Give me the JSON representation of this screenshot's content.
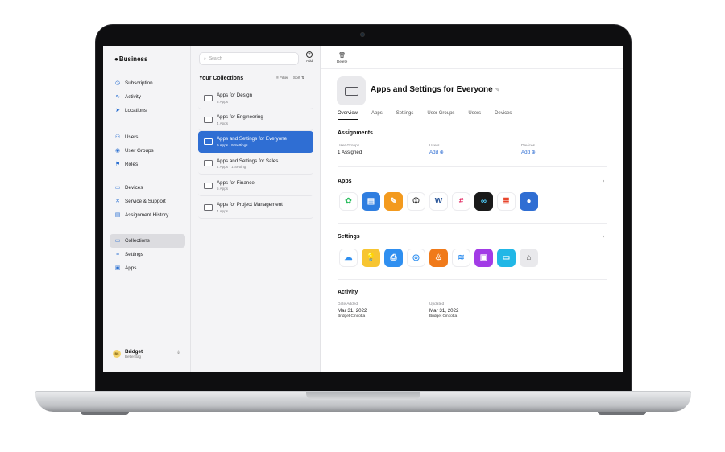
{
  "sidebar": {
    "brand": "Business",
    "groups": [
      [
        {
          "label": "Subscription",
          "icon": "clock-icon"
        },
        {
          "label": "Activity",
          "icon": "activity-icon"
        },
        {
          "label": "Locations",
          "icon": "location-icon"
        }
      ],
      [
        {
          "label": "Users",
          "icon": "users-icon"
        },
        {
          "label": "User Groups",
          "icon": "user-group-icon"
        },
        {
          "label": "Roles",
          "icon": "flag-icon"
        }
      ],
      [
        {
          "label": "Devices",
          "icon": "devices-icon"
        },
        {
          "label": "Service & Support",
          "icon": "tools-icon"
        },
        {
          "label": "Assignment History",
          "icon": "history-icon"
        }
      ],
      [
        {
          "label": "Collections",
          "icon": "collections-icon",
          "active": true
        },
        {
          "label": "Settings",
          "icon": "settings-icon"
        },
        {
          "label": "Apps",
          "icon": "apps-icon"
        }
      ]
    ],
    "user": {
      "initials": "BC",
      "name": "Bridget",
      "org": "BetterBag"
    }
  },
  "collections": {
    "search_placeholder": "Search",
    "add_label": "Add",
    "title": "Your Collections",
    "filter_label": "Filter",
    "sort_label": "Sort",
    "items": [
      {
        "name": "Apps for Design",
        "meta": "3 Apps"
      },
      {
        "name": "Apps for Engineering",
        "meta": "4 Apps"
      },
      {
        "name": "Apps and Settings for Everyone",
        "meta": "9 Apps · 9 Settings",
        "selected": true
      },
      {
        "name": "Apps and Settings for Sales",
        "meta": "4 Apps · 1 Setting"
      },
      {
        "name": "Apps for Finance",
        "meta": "5 Apps"
      },
      {
        "name": "Apps for Project Management",
        "meta": "4 Apps"
      }
    ]
  },
  "detail": {
    "delete_label": "Delete",
    "title": "Apps and Settings for Everyone",
    "tabs": [
      "Overview",
      "Apps",
      "Settings",
      "User Groups",
      "Users",
      "Devices"
    ],
    "active_tab": "Overview",
    "assignments": {
      "title": "Assignments",
      "user_groups_label": "User Groups",
      "user_groups_value": "1 Assigned",
      "users_label": "Users",
      "users_value": "Add",
      "devices_label": "Devices",
      "devices_value": "Add"
    },
    "apps_title": "Apps",
    "apps": [
      {
        "name": "evernote-icon",
        "bg": "#ffffff",
        "fg": "#2dbe60",
        "glyph": "✿"
      },
      {
        "name": "keynote-icon",
        "bg": "#2f7ee0",
        "fg": "#ffffff",
        "glyph": "▤"
      },
      {
        "name": "pages-icon",
        "bg": "#f39a1e",
        "fg": "#ffffff",
        "glyph": "✎"
      },
      {
        "name": "1password-icon",
        "bg": "#ffffff",
        "fg": "#1a1a1a",
        "glyph": "①"
      },
      {
        "name": "word-icon",
        "bg": "#ffffff",
        "fg": "#2b579a",
        "glyph": "W"
      },
      {
        "name": "slack-icon",
        "bg": "#ffffff",
        "fg": "#e01e5a",
        "glyph": "#"
      },
      {
        "name": "webex-icon",
        "bg": "#1a1a1a",
        "fg": "#4fd1ff",
        "glyph": "∞"
      },
      {
        "name": "speaker-deck-icon",
        "bg": "#ffffff",
        "fg": "#e8452c",
        "glyph": "≣"
      },
      {
        "name": "apple-app-icon",
        "bg": "#2f6ed3",
        "fg": "#ffffff",
        "glyph": "●"
      }
    ],
    "settings_title": "Settings",
    "settings": [
      {
        "name": "icloud-icon",
        "bg": "#ffffff",
        "fg": "#2f8ff0",
        "glyph": "☁"
      },
      {
        "name": "tips-icon",
        "bg": "#f7c531",
        "fg": "#ffffff",
        "glyph": "💡"
      },
      {
        "name": "printer-icon",
        "bg": "#2f8ff0",
        "fg": "#ffffff",
        "glyph": "⎙"
      },
      {
        "name": "globe-icon",
        "bg": "#ffffff",
        "fg": "#2f8ff0",
        "glyph": "◎"
      },
      {
        "name": "flame-icon",
        "bg": "#f07a1a",
        "fg": "#ffffff",
        "glyph": "♨"
      },
      {
        "name": "wifi-icon",
        "bg": "#ffffff",
        "fg": "#2f8ff0",
        "glyph": "≋"
      },
      {
        "name": "lock-icon",
        "bg": "#a23be6",
        "fg": "#ffffff",
        "glyph": "▣"
      },
      {
        "name": "airplay-icon",
        "bg": "#21b7e6",
        "fg": "#ffffff",
        "glyph": "▭"
      },
      {
        "name": "home-icon",
        "bg": "#e9e9ec",
        "fg": "#444444",
        "glyph": "⌂"
      }
    ],
    "activity": {
      "title": "Activity",
      "added_label": "Date Added",
      "added_date": "Mar 31, 2022",
      "added_by": "Bridget Cincotta",
      "updated_label": "Updated",
      "updated_date": "Mar 31, 2022",
      "updated_by": "Bridget Cincotta"
    }
  }
}
